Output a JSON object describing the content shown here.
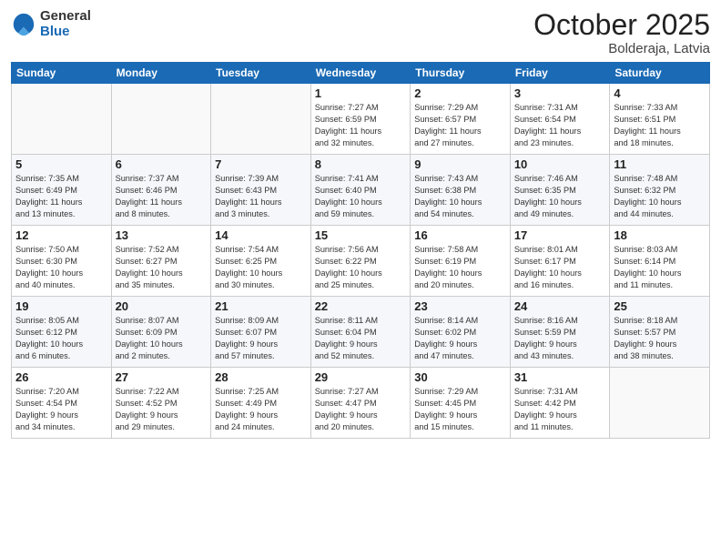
{
  "logo": {
    "general": "General",
    "blue": "Blue"
  },
  "header": {
    "month": "October 2025",
    "location": "Bolderaja, Latvia"
  },
  "days_of_week": [
    "Sunday",
    "Monday",
    "Tuesday",
    "Wednesday",
    "Thursday",
    "Friday",
    "Saturday"
  ],
  "weeks": [
    [
      {
        "day": "",
        "info": ""
      },
      {
        "day": "",
        "info": ""
      },
      {
        "day": "",
        "info": ""
      },
      {
        "day": "1",
        "info": "Sunrise: 7:27 AM\nSunset: 6:59 PM\nDaylight: 11 hours\nand 32 minutes."
      },
      {
        "day": "2",
        "info": "Sunrise: 7:29 AM\nSunset: 6:57 PM\nDaylight: 11 hours\nand 27 minutes."
      },
      {
        "day": "3",
        "info": "Sunrise: 7:31 AM\nSunset: 6:54 PM\nDaylight: 11 hours\nand 23 minutes."
      },
      {
        "day": "4",
        "info": "Sunrise: 7:33 AM\nSunset: 6:51 PM\nDaylight: 11 hours\nand 18 minutes."
      }
    ],
    [
      {
        "day": "5",
        "info": "Sunrise: 7:35 AM\nSunset: 6:49 PM\nDaylight: 11 hours\nand 13 minutes."
      },
      {
        "day": "6",
        "info": "Sunrise: 7:37 AM\nSunset: 6:46 PM\nDaylight: 11 hours\nand 8 minutes."
      },
      {
        "day": "7",
        "info": "Sunrise: 7:39 AM\nSunset: 6:43 PM\nDaylight: 11 hours\nand 3 minutes."
      },
      {
        "day": "8",
        "info": "Sunrise: 7:41 AM\nSunset: 6:40 PM\nDaylight: 10 hours\nand 59 minutes."
      },
      {
        "day": "9",
        "info": "Sunrise: 7:43 AM\nSunset: 6:38 PM\nDaylight: 10 hours\nand 54 minutes."
      },
      {
        "day": "10",
        "info": "Sunrise: 7:46 AM\nSunset: 6:35 PM\nDaylight: 10 hours\nand 49 minutes."
      },
      {
        "day": "11",
        "info": "Sunrise: 7:48 AM\nSunset: 6:32 PM\nDaylight: 10 hours\nand 44 minutes."
      }
    ],
    [
      {
        "day": "12",
        "info": "Sunrise: 7:50 AM\nSunset: 6:30 PM\nDaylight: 10 hours\nand 40 minutes."
      },
      {
        "day": "13",
        "info": "Sunrise: 7:52 AM\nSunset: 6:27 PM\nDaylight: 10 hours\nand 35 minutes."
      },
      {
        "day": "14",
        "info": "Sunrise: 7:54 AM\nSunset: 6:25 PM\nDaylight: 10 hours\nand 30 minutes."
      },
      {
        "day": "15",
        "info": "Sunrise: 7:56 AM\nSunset: 6:22 PM\nDaylight: 10 hours\nand 25 minutes."
      },
      {
        "day": "16",
        "info": "Sunrise: 7:58 AM\nSunset: 6:19 PM\nDaylight: 10 hours\nand 20 minutes."
      },
      {
        "day": "17",
        "info": "Sunrise: 8:01 AM\nSunset: 6:17 PM\nDaylight: 10 hours\nand 16 minutes."
      },
      {
        "day": "18",
        "info": "Sunrise: 8:03 AM\nSunset: 6:14 PM\nDaylight: 10 hours\nand 11 minutes."
      }
    ],
    [
      {
        "day": "19",
        "info": "Sunrise: 8:05 AM\nSunset: 6:12 PM\nDaylight: 10 hours\nand 6 minutes."
      },
      {
        "day": "20",
        "info": "Sunrise: 8:07 AM\nSunset: 6:09 PM\nDaylight: 10 hours\nand 2 minutes."
      },
      {
        "day": "21",
        "info": "Sunrise: 8:09 AM\nSunset: 6:07 PM\nDaylight: 9 hours\nand 57 minutes."
      },
      {
        "day": "22",
        "info": "Sunrise: 8:11 AM\nSunset: 6:04 PM\nDaylight: 9 hours\nand 52 minutes."
      },
      {
        "day": "23",
        "info": "Sunrise: 8:14 AM\nSunset: 6:02 PM\nDaylight: 9 hours\nand 47 minutes."
      },
      {
        "day": "24",
        "info": "Sunrise: 8:16 AM\nSunset: 5:59 PM\nDaylight: 9 hours\nand 43 minutes."
      },
      {
        "day": "25",
        "info": "Sunrise: 8:18 AM\nSunset: 5:57 PM\nDaylight: 9 hours\nand 38 minutes."
      }
    ],
    [
      {
        "day": "26",
        "info": "Sunrise: 7:20 AM\nSunset: 4:54 PM\nDaylight: 9 hours\nand 34 minutes."
      },
      {
        "day": "27",
        "info": "Sunrise: 7:22 AM\nSunset: 4:52 PM\nDaylight: 9 hours\nand 29 minutes."
      },
      {
        "day": "28",
        "info": "Sunrise: 7:25 AM\nSunset: 4:49 PM\nDaylight: 9 hours\nand 24 minutes."
      },
      {
        "day": "29",
        "info": "Sunrise: 7:27 AM\nSunset: 4:47 PM\nDaylight: 9 hours\nand 20 minutes."
      },
      {
        "day": "30",
        "info": "Sunrise: 7:29 AM\nSunset: 4:45 PM\nDaylight: 9 hours\nand 15 minutes."
      },
      {
        "day": "31",
        "info": "Sunrise: 7:31 AM\nSunset: 4:42 PM\nDaylight: 9 hours\nand 11 minutes."
      },
      {
        "day": "",
        "info": ""
      }
    ]
  ]
}
